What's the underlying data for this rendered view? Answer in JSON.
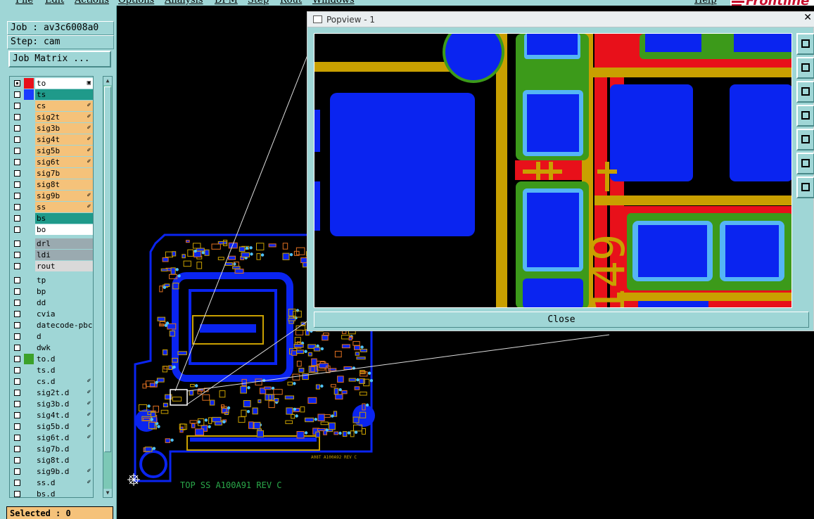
{
  "menu": [
    "File",
    "Edit",
    "Actions",
    "Options",
    "Analysis",
    "DFM",
    "Step",
    "Rout",
    "Windows",
    "Help"
  ],
  "brand": "Frontline",
  "job": {
    "label": "Job : av3c6008a0",
    "step": "Step: cam"
  },
  "job_matrix_button": "Job Matrix ...",
  "layers": [
    {
      "name": "to",
      "bg": "#ffffff",
      "swatch": "#e8101a",
      "mark": "▣",
      "checked": true
    },
    {
      "name": "ts",
      "bg": "#1f9a8a",
      "swatch": "#1a3bff",
      "mark": "",
      "checked": false
    },
    {
      "name": "cs",
      "bg": "#f5c27a",
      "swatch": "",
      "mark": "✐",
      "checked": false
    },
    {
      "name": "sig2t",
      "bg": "#f5c27a",
      "swatch": "",
      "mark": "✐",
      "checked": false
    },
    {
      "name": "sig3b",
      "bg": "#f5c27a",
      "swatch": "",
      "mark": "✐",
      "checked": false
    },
    {
      "name": "sig4t",
      "bg": "#f5c27a",
      "swatch": "",
      "mark": "✐",
      "checked": false
    },
    {
      "name": "sig5b",
      "bg": "#f5c27a",
      "swatch": "",
      "mark": "✐",
      "checked": false
    },
    {
      "name": "sig6t",
      "bg": "#f5c27a",
      "swatch": "",
      "mark": "✐",
      "checked": false
    },
    {
      "name": "sig7b",
      "bg": "#f5c27a",
      "swatch": "",
      "mark": "",
      "checked": false
    },
    {
      "name": "sig8t",
      "bg": "#f5c27a",
      "swatch": "",
      "mark": "",
      "checked": false
    },
    {
      "name": "sig9b",
      "bg": "#f5c27a",
      "swatch": "",
      "mark": "✐",
      "checked": false
    },
    {
      "name": "ss",
      "bg": "#f5c27a",
      "swatch": "",
      "mark": "✐",
      "checked": false
    },
    {
      "name": "bs",
      "bg": "#1f9a8a",
      "swatch": "",
      "mark": "",
      "checked": false
    },
    {
      "name": "bo",
      "bg": "#ffffff",
      "swatch": "",
      "mark": "",
      "checked": false
    },
    {
      "name": "drl",
      "bg": "#9aaab0",
      "swatch": "",
      "mark": "",
      "checked": false
    },
    {
      "name": "ldi",
      "bg": "#9aaab0",
      "swatch": "",
      "mark": "",
      "checked": false
    },
    {
      "name": "rout",
      "bg": "#d9d9d9",
      "swatch": "",
      "mark": "",
      "checked": false
    },
    {
      "name": "tp",
      "bg": "#9fd6d6",
      "swatch": "",
      "mark": "",
      "checked": false
    },
    {
      "name": "bp",
      "bg": "#9fd6d6",
      "swatch": "",
      "mark": "",
      "checked": false
    },
    {
      "name": "dd",
      "bg": "#9fd6d6",
      "swatch": "",
      "mark": "",
      "checked": false
    },
    {
      "name": "cvia",
      "bg": "#9fd6d6",
      "swatch": "",
      "mark": "",
      "checked": false
    },
    {
      "name": "datecode-pbc",
      "bg": "#9fd6d6",
      "swatch": "",
      "mark": "",
      "checked": false
    },
    {
      "name": "d",
      "bg": "#9fd6d6",
      "swatch": "",
      "mark": "",
      "checked": false
    },
    {
      "name": "dwk",
      "bg": "#9fd6d6",
      "swatch": "",
      "mark": "",
      "checked": false
    },
    {
      "name": "to.d",
      "bg": "#9fd6d6",
      "swatch": "#3ca12a",
      "mark": "",
      "checked": false
    },
    {
      "name": "ts.d",
      "bg": "#9fd6d6",
      "swatch": "",
      "mark": "",
      "checked": false
    },
    {
      "name": "cs.d",
      "bg": "#9fd6d6",
      "swatch": "",
      "mark": "✐",
      "checked": false
    },
    {
      "name": "sig2t.d",
      "bg": "#9fd6d6",
      "swatch": "",
      "mark": "✐",
      "checked": false
    },
    {
      "name": "sig3b.d",
      "bg": "#9fd6d6",
      "swatch": "",
      "mark": "✐",
      "checked": false
    },
    {
      "name": "sig4t.d",
      "bg": "#9fd6d6",
      "swatch": "",
      "mark": "✐",
      "checked": false
    },
    {
      "name": "sig5b.d",
      "bg": "#9fd6d6",
      "swatch": "",
      "mark": "✐",
      "checked": false
    },
    {
      "name": "sig6t.d",
      "bg": "#9fd6d6",
      "swatch": "",
      "mark": "✐",
      "checked": false
    },
    {
      "name": "sig7b.d",
      "bg": "#9fd6d6",
      "swatch": "",
      "mark": "",
      "checked": false
    },
    {
      "name": "sig8t.d",
      "bg": "#9fd6d6",
      "swatch": "",
      "mark": "",
      "checked": false
    },
    {
      "name": "sig9b.d",
      "bg": "#9fd6d6",
      "swatch": "",
      "mark": "✐",
      "checked": false
    },
    {
      "name": "ss.d",
      "bg": "#9fd6d6",
      "swatch": "",
      "mark": "✐",
      "checked": false
    },
    {
      "name": "bs.d",
      "bg": "#9fd6d6",
      "swatch": "",
      "mark": "",
      "checked": false
    }
  ],
  "selected": "Selected : 0",
  "board": {
    "footer_text": "TOP SS  A100A91 REV C",
    "edge_text": "A08T A100A92 REV C"
  },
  "popview": {
    "title": "Popview - 1",
    "close_label": "Close",
    "close_glyph": "✕",
    "silk_text": "149"
  },
  "colors": {
    "panel": "#9fd6d6",
    "pad": "#0a24f0",
    "trace": "#c9a000",
    "mask": "#3c9a1a",
    "plane": "#e8101a",
    "silk": "#2aa84a"
  }
}
